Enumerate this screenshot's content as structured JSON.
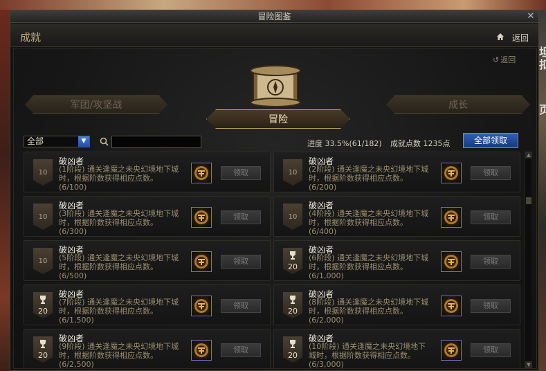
{
  "window": {
    "title": "冒险图鉴"
  },
  "header": {
    "section_title": "成就",
    "home_back_label": "返回"
  },
  "panel": {
    "back_label": "返回"
  },
  "tabs": {
    "left": "军团/攻坚战",
    "active": "冒险",
    "right": "成长"
  },
  "filter": {
    "selected": "全部",
    "search_placeholder": ""
  },
  "stats": {
    "progress": "进度  33.5%(61/182)",
    "points": "成就点数 1235点"
  },
  "claim_all_label": "全部领取",
  "achievements": [
    {
      "title": "破凶者",
      "desc": "(1阶段) 通关逢魔之未央幻境地下城时，根据阶数获得相应点数。",
      "progress": "(6/100)",
      "badge": "10",
      "trophy": false,
      "claim": "领取"
    },
    {
      "title": "破凶者",
      "desc": "(2阶段) 通关逢魔之未央幻境地下城时，根据阶数获得相应点数。",
      "progress": "(6/200)",
      "badge": "10",
      "trophy": false,
      "claim": "领取"
    },
    {
      "title": "破凶者",
      "desc": "(3阶段) 通关逢魔之未央幻境地下城时，根据阶数获得相应点数。",
      "progress": "(6/300)",
      "badge": "10",
      "trophy": false,
      "claim": "领取"
    },
    {
      "title": "破凶者",
      "desc": "(4阶段) 通关逢魔之未央幻境地下城时，根据阶数获得相应点数。",
      "progress": "(6/400)",
      "badge": "10",
      "trophy": false,
      "claim": "领取"
    },
    {
      "title": "破凶者",
      "desc": "(5阶段) 通关逢魔之未央幻境地下城时，根据阶数获得相应点数。",
      "progress": "(6/500)",
      "badge": "10",
      "trophy": false,
      "claim": "领取"
    },
    {
      "title": "破凶者",
      "desc": "(6阶段) 通关逢魔之未央幻境地下城时，根据阶数获得相应点数。",
      "progress": "(6/1,000)",
      "badge": "20",
      "trophy": true,
      "claim": "领取"
    },
    {
      "title": "破凶者",
      "desc": "(7阶段) 通关逢魔之未央幻境地下城时，根据阶数获得相应点数。",
      "progress": "(6/1,500)",
      "badge": "20",
      "trophy": true,
      "claim": "领取"
    },
    {
      "title": "破凶者",
      "desc": "(8阶段) 通关逢魔之未央幻境地下城时，根据阶数获得相应点数。",
      "progress": "(6/2,000)",
      "badge": "20",
      "trophy": true,
      "claim": "领取"
    },
    {
      "title": "破凶者",
      "desc": "(9阶段) 通关逢魔之未央幻境地下城时，根据阶数获得相应点数。",
      "progress": "(6/2,500)",
      "badge": "20",
      "trophy": true,
      "claim": "领取"
    },
    {
      "title": "破凶者",
      "desc": "(10阶段) 通关逢魔之未央幻境地下城时，根据阶数获得相应点数。",
      "progress": "(6/3,000)",
      "badge": "20",
      "trophy": true,
      "claim": "领取"
    }
  ],
  "background_glyphs": {
    "right_1": "坦",
    "right_2": "扣",
    "right_3": "页"
  },
  "colors": {
    "accent_blue": "#2f5fb7",
    "gold": "#b99b63",
    "frame": "#4a4232"
  }
}
